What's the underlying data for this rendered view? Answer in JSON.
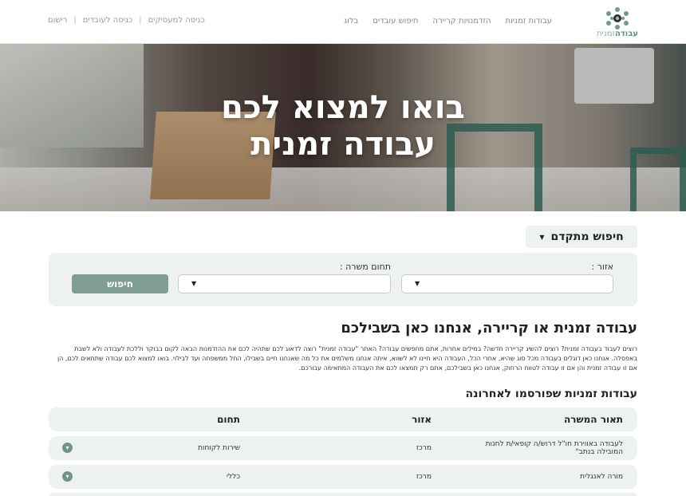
{
  "header": {
    "logo": {
      "text_bold": "עבודה",
      "text_light": "זמנית"
    },
    "nav": [
      "עבודות זמניות",
      "הזדמנויות קריירה",
      "חיפוש עובדים",
      "בלוג"
    ],
    "auth": {
      "employers": "כניסה למעסיקים",
      "workers": "כניסה לעובדים",
      "register": "רישום"
    }
  },
  "hero": {
    "line1": "בואו למצוא לכם",
    "line2": "עבודה זמנית"
  },
  "search": {
    "advanced_label": "חיפוש מתקדם",
    "area_label": "אזור :",
    "field_label": "תחום משרה :",
    "button_label": "חיפוש"
  },
  "intro": {
    "title": "עבודה זמנית או קריירה, אנחנו כאן בשבילכם",
    "text": "רוצים לעבוד בעבודה זמנית? רוצים להשיג קריירה חדשה? במילים אחרות, אתם מחפשים עבודה? האתר \"עבודה זמנית\" רוצה לדאוג לכם שתהיה לכם את ההזדמנות הבאה לקום בבוקר וללכת לעבודה ולא לשבת באפסלה. אנחנו כאן דוגלים בעבודה מכל סוג שהיא, אחרי הכל, העבודה היא חיינו לא לשווא, איתה אנחנו משלמים את כל מה שאנחנו חיים בשבילו, החל ממשפחה ועד לבילוי. בואו למצוא לכם עבודה שתתאים לכם, הן אם זו עבודה זמנית והן אם זו עבודה לטווח הרחוק, אנחנו כאן בשבילכם, אתם רק תמצאו לכם את העבודה המתאימה עבורכם."
  },
  "jobs": {
    "title": "עבודות זמניות שפורסמו לאחרונה",
    "headers": {
      "description": "תאור המשרה",
      "area": "אזור",
      "field": "תחום"
    },
    "rows": [
      {
        "description": "לעבודה באווירת חו\"ל דרוש/ה קופאי/ת לחנות המובילה בנתב\"",
        "area": "מרכז",
        "field": "שירות לקוחות"
      },
      {
        "description": "מורה לאנגלית",
        "area": "מרכז",
        "field": "כללי"
      }
    ]
  },
  "colors": {
    "accent": "#7f9d90",
    "panel": "#eef2ef",
    "logo": "#5f8f87"
  }
}
